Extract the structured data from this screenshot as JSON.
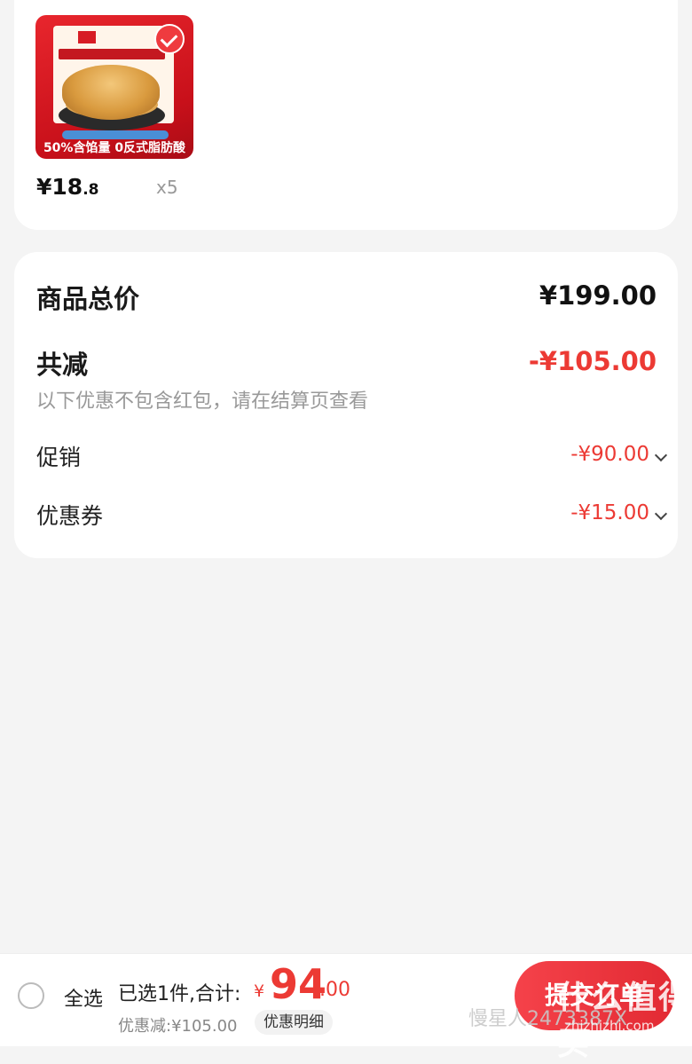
{
  "product": {
    "image_bottom_text": "50%含馅量 0反式脂肪酸",
    "price_int": "¥18",
    "price_dec": ".8",
    "quantity": "x5"
  },
  "summary": {
    "total_label": "商品总价",
    "total_value": "¥199.00",
    "reduce_label": "共减",
    "reduce_value": "-¥105.00",
    "note": "以下优惠不包含红包，请在结算页查看",
    "promo_label": "促销",
    "promo_value": "-¥90.00",
    "coupon_label": "优惠券",
    "coupon_value": "-¥15.00"
  },
  "bottom_bar": {
    "select_all": "全选",
    "selected_text": "已选1件,合计:",
    "currency": "¥",
    "amount_int": "94",
    "amount_dec": ".00",
    "discount_text": "优惠减:¥105.00",
    "detail_button": "优惠明细",
    "checkout_button": "提交订单"
  },
  "watermark": {
    "site": "什么值得买",
    "user": "慢星人2473387X",
    "domain": "zhizhizhi.com"
  },
  "colors": {
    "accent": "#ec3a34",
    "background": "#f4f4f4"
  }
}
